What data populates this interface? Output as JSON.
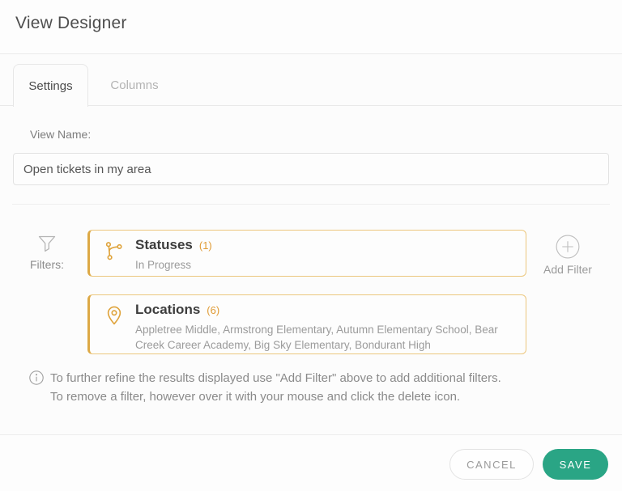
{
  "dialog": {
    "title": "View Designer"
  },
  "tabs": [
    {
      "label": "Settings",
      "active": true
    },
    {
      "label": "Columns",
      "active": false
    }
  ],
  "form": {
    "view_name_label": "View Name:",
    "view_name_value": "Open tickets in my area"
  },
  "filters": {
    "label": "Filters:",
    "icon": "funnel-icon",
    "items": [
      {
        "icon": "branch-icon",
        "name": "Statuses",
        "count": "(1)",
        "summary": "In Progress"
      },
      {
        "icon": "map-pin-icon",
        "name": "Locations",
        "count": "(6)",
        "summary": "Appletree Middle, Armstrong Elementary, Autumn Elementary School, Bear Creek Career Academy, Big Sky Elementary, Bondurant High",
        "locations": [
          "Appletree Middle",
          "Armstrong Elementary",
          "Autumn Elementary School",
          "Bear Creek Career Academy",
          "Big Sky Elementary",
          "Bondurant High"
        ]
      }
    ],
    "add_filter_label": "Add Filter",
    "add_filter_icon": "plus-circle-icon"
  },
  "note": {
    "icon": "info-icon",
    "line1": "To further refine the results displayed use \"Add Filter\" above to add additional filters.",
    "line2": "To remove a filter, however over it with your mouse and click the delete icon."
  },
  "footer": {
    "cancel_label": "CANCEL",
    "save_label": "SAVE"
  },
  "colors": {
    "accent_orange": "#dfa33b",
    "card_border": "#ecc77e",
    "card_border_left": "#dda945",
    "count_orange": "#e09b35",
    "save_green": "#2aa585"
  }
}
